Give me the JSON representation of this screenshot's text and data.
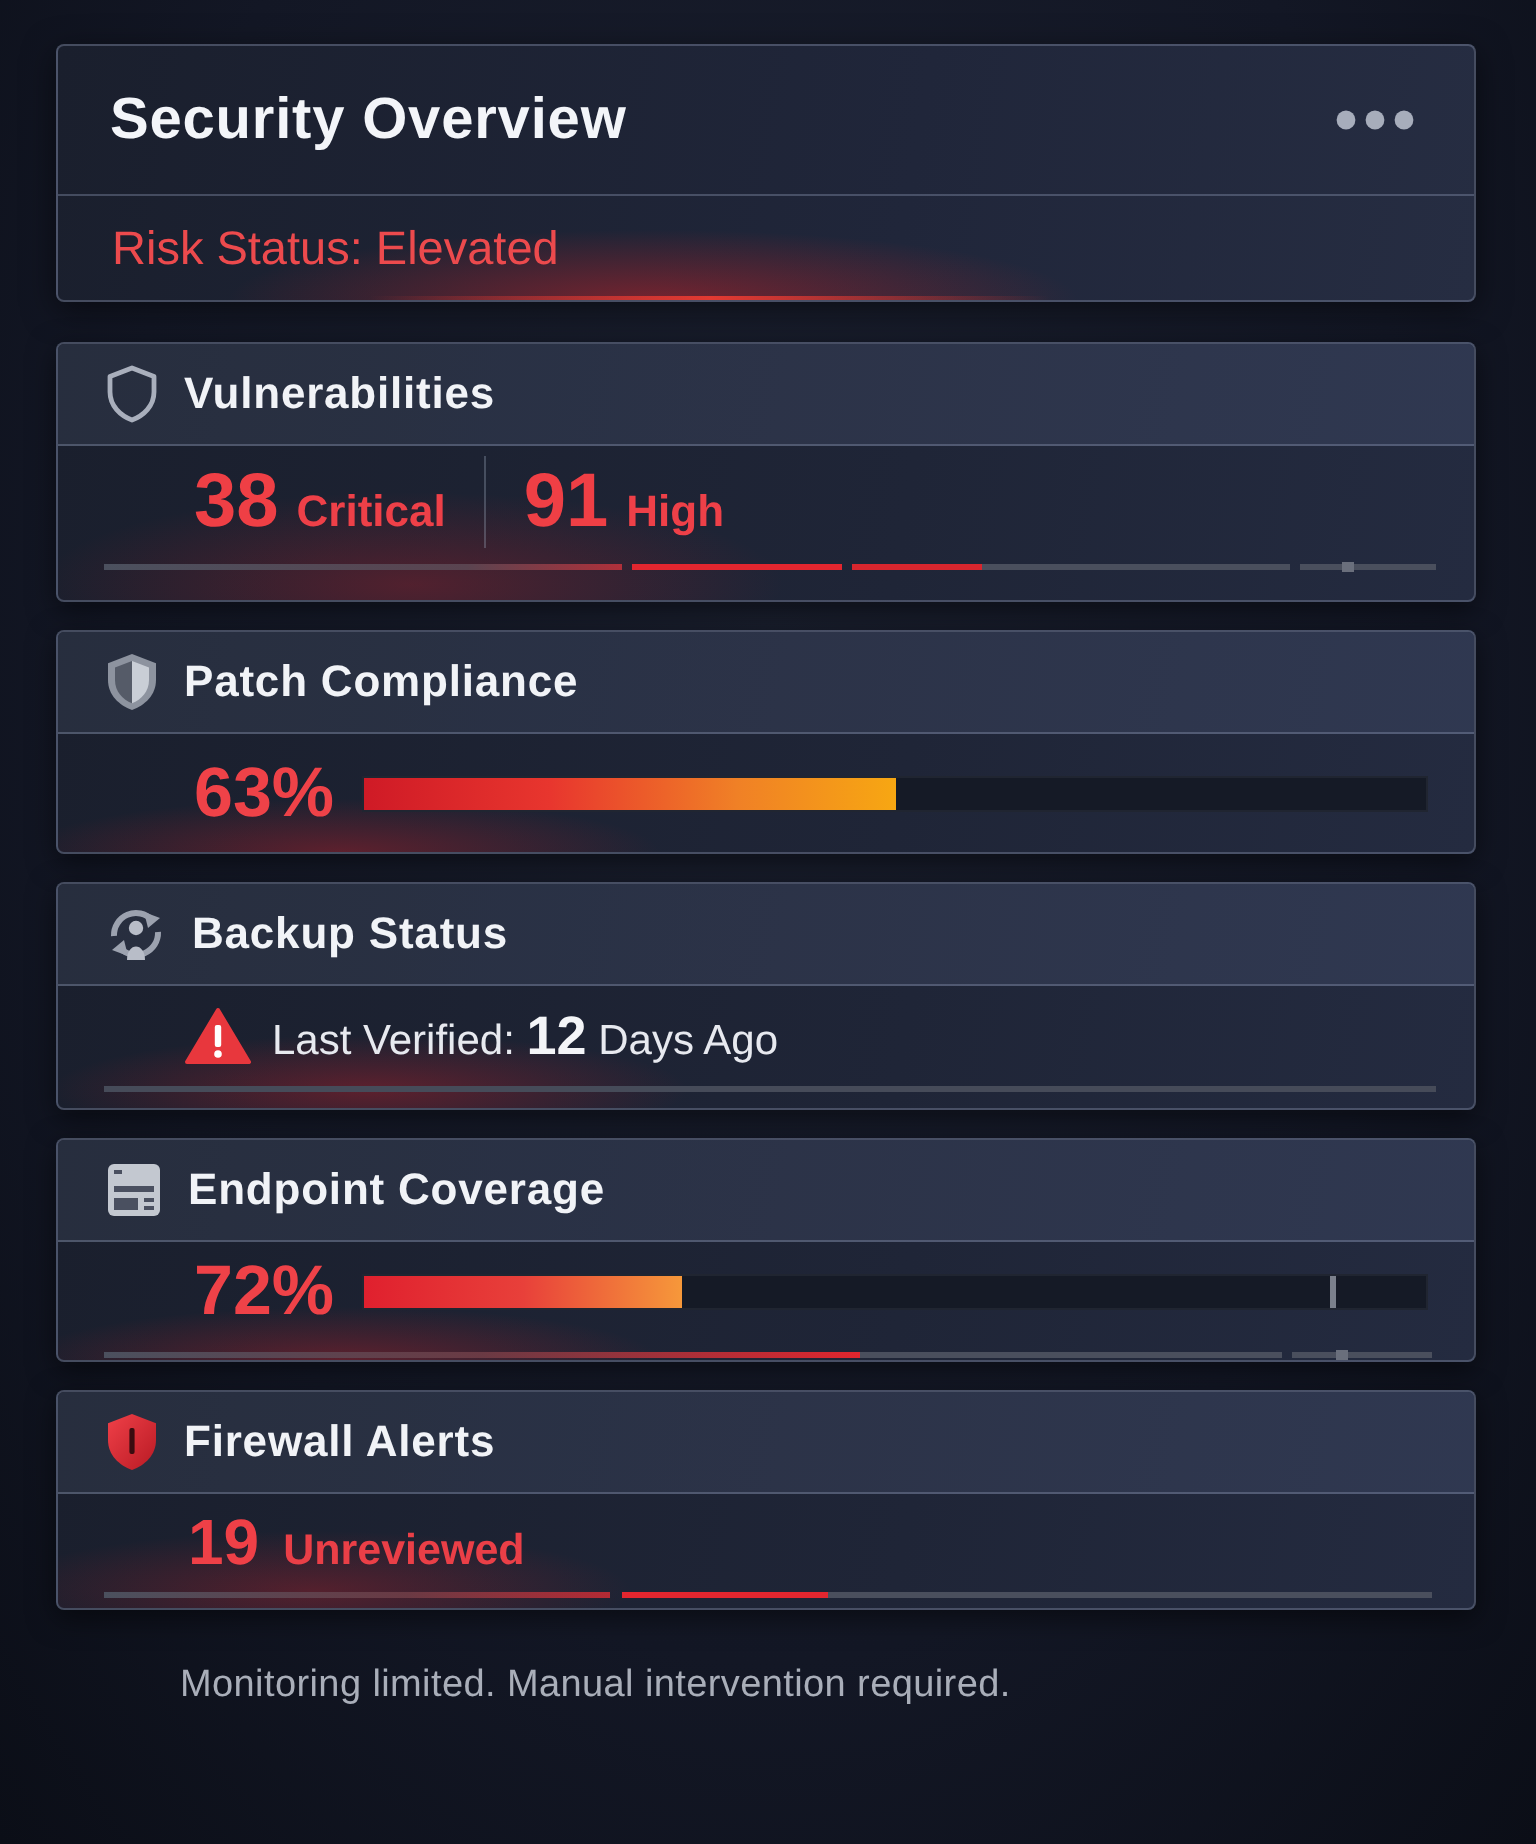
{
  "overview": {
    "title": "Security Overview",
    "risk_status": "Risk Status: Elevated"
  },
  "cards": [
    {
      "kind": "counts",
      "title": "Vulnerabilities",
      "counts": [
        {
          "count": "38",
          "severity": "Critical"
        },
        {
          "count": "91",
          "severity": "High"
        }
      ]
    },
    {
      "kind": "progress",
      "title": "Patch Compliance",
      "value": "63%",
      "level": 0.5
    },
    {
      "kind": "status",
      "title": "Backup Status",
      "text": "Last Verified: **12** Days Ago"
    },
    {
      "kind": "progress",
      "title": "Endpoint Coverage",
      "value": "72%",
      "level": 0.3
    },
    {
      "kind": "alerts",
      "title": "Firewall Alerts",
      "count": "19",
      "label": "Unreviewed"
    }
  ],
  "footer": "Monitoring limited. Manual intervention required."
}
